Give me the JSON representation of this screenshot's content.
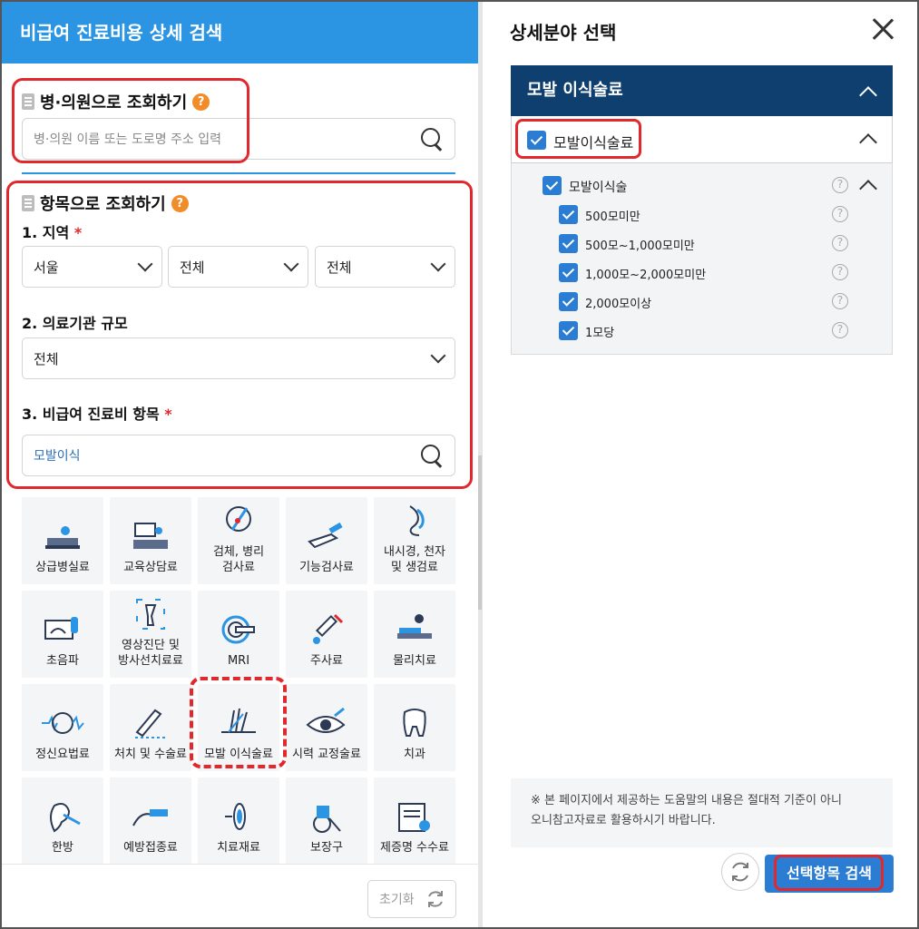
{
  "left_panel": {
    "header_title": "비급여 진료비용 상세 검색",
    "hospital_section": {
      "title": "병·의원으로 조회하기",
      "help": "?",
      "search_placeholder": "병·의원 이름 또는 도로명 주소 입력"
    },
    "item_section": {
      "title": "항목으로 조회하기",
      "help": "?",
      "region_label": "1. 지역",
      "required_mark": "*",
      "region_selects": [
        "서울",
        "전체",
        "전체"
      ],
      "scale_label": "2. 의료기관 규모",
      "scale_select": "전체",
      "item_label": "3. 비급여 진료비 항목",
      "item_search_value": "모발이식"
    },
    "categories": [
      {
        "label": "상급병실료",
        "icon": "hospital-bed-icon"
      },
      {
        "label": "교육상담료",
        "icon": "counseling-desk-icon"
      },
      {
        "label": "검체, 병리\n검사료",
        "icon": "specimen-test-icon"
      },
      {
        "label": "기능검사료",
        "icon": "function-test-icon"
      },
      {
        "label": "내시경, 천자\n및 생검료",
        "icon": "endoscope-icon"
      },
      {
        "label": "초음파",
        "icon": "ultrasound-icon"
      },
      {
        "label": "영상진단 및\n방사선치료료",
        "icon": "xray-bone-icon"
      },
      {
        "label": "MRI",
        "icon": "mri-scanner-icon"
      },
      {
        "label": "주사료",
        "icon": "syringe-icon"
      },
      {
        "label": "물리치료",
        "icon": "physical-therapy-icon"
      },
      {
        "label": "정신요법료",
        "icon": "brain-wave-icon"
      },
      {
        "label": "처치 및 수술료",
        "icon": "scalpel-hand-icon"
      },
      {
        "label": "모발 이식술료",
        "icon": "hair-transplant-icon"
      },
      {
        "label": "시력 교정술료",
        "icon": "eye-laser-icon"
      },
      {
        "label": "치과",
        "icon": "tooth-icon"
      },
      {
        "label": "한방",
        "icon": "acupuncture-ear-icon"
      },
      {
        "label": "예방접종료",
        "icon": "vaccination-icon"
      },
      {
        "label": "치료재료",
        "icon": "lens-material-icon"
      },
      {
        "label": "보장구",
        "icon": "wheelchair-icon"
      },
      {
        "label": "제증명 수수료",
        "icon": "certificate-icon"
      }
    ],
    "reset_label": "초기화"
  },
  "right_panel": {
    "title": "상세분야 선택",
    "accordion_title": "모발 이식술료",
    "group_label": "모발이식술료",
    "subgroup_label": "모발이식술",
    "items": [
      "500모미만",
      "500모~1,000모미만",
      "1,000모~2,000모미만",
      "2,000모이상",
      "1모당"
    ],
    "help": "?",
    "notice": "※ 본 페이지에서 제공하는 도움말의 내용은 절대적 기준이 아니\n오니참고자료로 활용하시기 바랍니다.",
    "search_button": "선택항목 검색"
  },
  "colors": {
    "header_blue": "#2b95e3",
    "accordion_navy": "#0e3f6f",
    "checkbox_blue": "#2b7cd3",
    "highlight_red": "#e0282d",
    "help_orange": "#f28c28"
  }
}
